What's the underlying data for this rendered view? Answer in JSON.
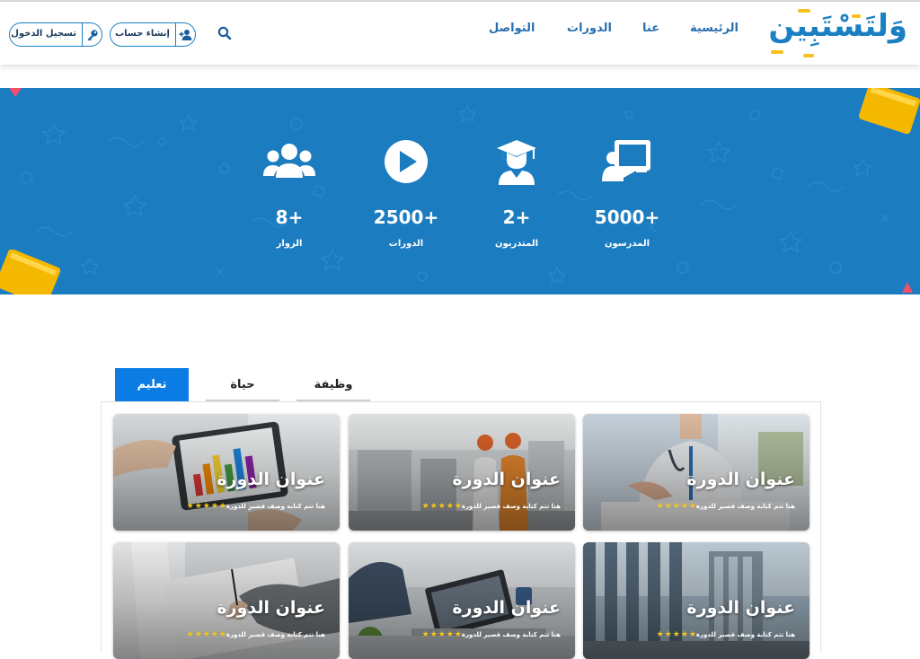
{
  "header": {
    "logo": {
      "text": "وَلتَسْتَبِين"
    },
    "nav": {
      "home": "الرئيسية",
      "about": "عنا",
      "courses": "الدورات",
      "contact": "التواصل"
    },
    "search": {
      "icon": "search-icon"
    },
    "register": {
      "label": "إنشاء حساب",
      "icon": "add-user-icon"
    },
    "login": {
      "label": "تسجيل الدخول",
      "icon": "key-icon"
    }
  },
  "stats": [
    {
      "value": "5000+",
      "label": "المدرسون",
      "icon": "teacher-board-icon"
    },
    {
      "value": "2+",
      "label": "المتدربون",
      "icon": "graduate-icon"
    },
    {
      "value": "2500+",
      "label": "الدورات",
      "icon": "play-circle-icon"
    },
    {
      "value": "8+",
      "label": "الزوار",
      "icon": "users-group-icon"
    }
  ],
  "colors": {
    "brand": "#1b7fc4",
    "banner": "#1c7cc0",
    "active_tab": "#0a7ce3",
    "star": "#f5c518",
    "accent_yellow": "#f7c21e"
  },
  "tabs": {
    "items": [
      {
        "label": "تعليم",
        "active": true
      },
      {
        "label": "حياة",
        "active": false
      },
      {
        "label": "وظيفة",
        "active": false
      }
    ]
  },
  "courses": [
    {
      "title": "عنوان الدورة",
      "description": "هنا تتم كتابة وصف قصير للدورة",
      "rating": 5,
      "image": "doctor-writing"
    },
    {
      "title": "عنوان الدورة",
      "description": "هنا تتم كتابة وصف قصير للدورة",
      "rating": 5,
      "image": "engineers-site"
    },
    {
      "title": "عنوان الدورة",
      "description": "هنا تتم كتابة وصف قصير للدورة",
      "rating": 5,
      "image": "charts-tablet"
    },
    {
      "title": "عنوان الدورة",
      "description": "هنا تتم كتابة وصف قصير للدورة",
      "rating": 5,
      "image": "office-building"
    },
    {
      "title": "عنوان الدورة",
      "description": "هنا تتم كتابة وصف قصير للدورة",
      "rating": 5,
      "image": "laptop-desk"
    },
    {
      "title": "عنوان الدورة",
      "description": "هنا تتم كتابة وصف قصير للدورة",
      "rating": 5,
      "image": "hand-writing-paper"
    }
  ]
}
